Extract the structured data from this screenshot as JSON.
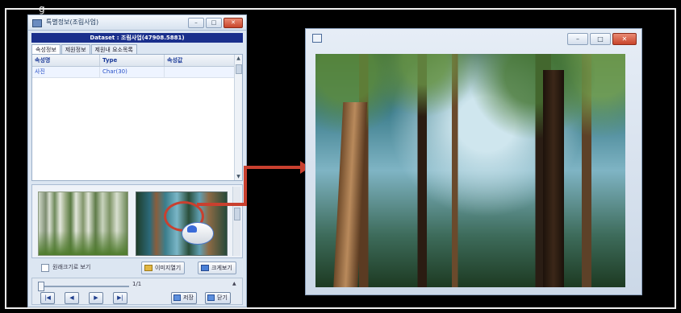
{
  "top_caption": "g",
  "left_dialog": {
    "title": "특별정보(조림사업)",
    "dataset_label": "Dataset : 조림사업(47908.5881)",
    "tabs": [
      {
        "label": "속성정보"
      },
      {
        "label": "제원정보"
      },
      {
        "label": "제원내 요소목록"
      }
    ],
    "grid": {
      "headers": [
        "속성명",
        "Type",
        "속성값"
      ],
      "rows": [
        [
          "사진",
          "Char(30)",
          ""
        ]
      ]
    },
    "original_size_checkbox_label": "원래크기로 보기",
    "open_image_button": "이미지열기",
    "zoom_button": "크게보기",
    "page_indicator": "1/1",
    "save_button": "저장",
    "close_button": "닫기"
  },
  "colors": {
    "dataset_bar": "#1a2f8c",
    "close_red": "#c8452b",
    "highlight_red": "#c9402f"
  },
  "icons": [
    "window-icon",
    "minimize-icon",
    "maximize-icon",
    "close-icon",
    "folder-icon",
    "zoom-icon",
    "first-icon",
    "prev-icon",
    "next-icon",
    "last-icon",
    "mouse-icon",
    "arrow-icon"
  ]
}
